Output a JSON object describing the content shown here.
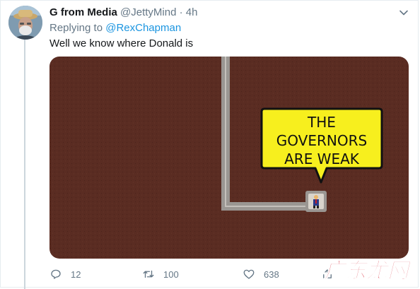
{
  "tweet": {
    "display_name": "G from Media",
    "handle": "@JettyMind",
    "separator": "·",
    "time": "4h",
    "replying_prefix": "Replying to ",
    "replying_to": "@RexChapman",
    "text": "Well we know where Donald is",
    "media": {
      "speech_bubble_lines": [
        "THE",
        "GOVERNORS",
        "ARE WEAK"
      ],
      "colors": {
        "background": "#5a2c22",
        "tunnel": "#9a9692",
        "bubble": "#f7ef1e"
      }
    },
    "actions": {
      "reply": {
        "icon": "reply-icon",
        "count": "12"
      },
      "retweet": {
        "icon": "retweet-icon",
        "count": "100"
      },
      "like": {
        "icon": "heart-icon",
        "count": "638"
      },
      "share": {
        "icon": "share-icon"
      }
    },
    "menu_icon": "chevron-down-icon"
  },
  "watermark": {
    "text": "广东龙网"
  }
}
